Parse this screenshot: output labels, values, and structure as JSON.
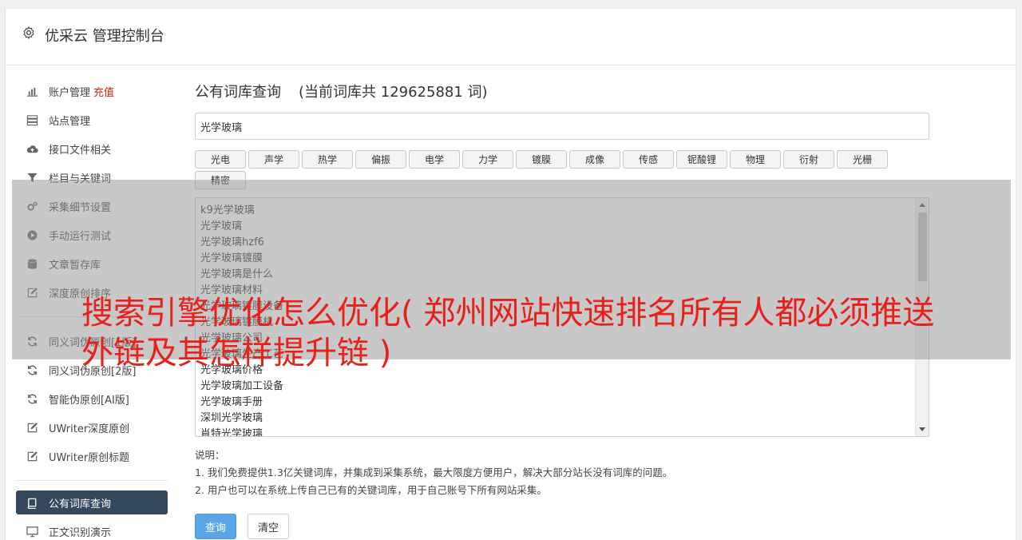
{
  "app": {
    "title": "优采云 管理控制台"
  },
  "sidebar": {
    "items": [
      {
        "label": "账户管理",
        "extra": "充值",
        "icon": "bar-chart-icon"
      },
      {
        "label": "站点管理",
        "icon": "server-icon"
      },
      {
        "label": "接口文件相关",
        "icon": "cloud-upload-icon"
      },
      {
        "label": "栏目与关键词",
        "icon": "filter-icon"
      },
      {
        "label": "采集细节设置",
        "icon": "cogs-icon"
      },
      {
        "label": "手动运行测试",
        "icon": "play-circle-icon"
      },
      {
        "label": "文章暂存库",
        "icon": "database-icon"
      },
      {
        "label": "深度原创排序",
        "icon": "edit-icon"
      }
    ],
    "items2": [
      {
        "label": "同义词伪原创[1版]",
        "icon": "refresh-icon"
      },
      {
        "label": "同义词伪原创[2版]",
        "icon": "refresh-icon"
      },
      {
        "label": "智能伪原创[AI版]",
        "icon": "refresh-icon"
      },
      {
        "label": "UWriter深度原创",
        "icon": "edit-icon"
      },
      {
        "label": "UWriter原创标题",
        "icon": "edit-icon"
      }
    ],
    "active": {
      "label": "公有词库查询",
      "icon": "book-icon"
    },
    "items3": [
      {
        "label": "正文识别演示",
        "icon": "desktop-icon"
      }
    ]
  },
  "main": {
    "heading": "公有词库查询",
    "count_text": "(当前词库共 129625881 词)",
    "search_value": "光学玻璃",
    "tags": [
      "光电",
      "声学",
      "热学",
      "偏振",
      "电学",
      "力学",
      "镀膜",
      "成像",
      "传感",
      "铌酸锂",
      "物理",
      "衍射",
      "光栅",
      "精密"
    ],
    "results": [
      "k9光学玻璃",
      "光学玻璃",
      "光学玻璃hzf6",
      "光学玻璃镀膜",
      "光学玻璃是什么",
      "光学玻璃材料",
      "光学玻璃镀膜设备",
      "光学玻璃镀膜机",
      "光学玻璃公司",
      "光学玻璃生产工艺",
      "光学玻璃价格",
      "光学玻璃加工设备",
      "光学玻璃手册",
      "深圳光学玻璃",
      "肖特光学玻璃"
    ],
    "notes_title": "说明：",
    "notes": [
      "1. 我们免费提供1.3亿关键词库，并集成到采集系统，最大限度方便用户，解决大部分站长没有词库的问题。",
      "2. 用户也可以在系统上传自己已有的关键词库，用于自己账号下所有网站采集。"
    ],
    "query_button": "查询",
    "clear_button": "清空"
  },
  "overlay": {
    "headline": "搜索引擎优化怎么优化( 郑州网站快速排名所有人都必须推送外链及其怎样提升链 )"
  },
  "colors": {
    "active_nav": "#34485e",
    "accent_red": "#e8201b",
    "primary_button": "#5aa7e8"
  }
}
